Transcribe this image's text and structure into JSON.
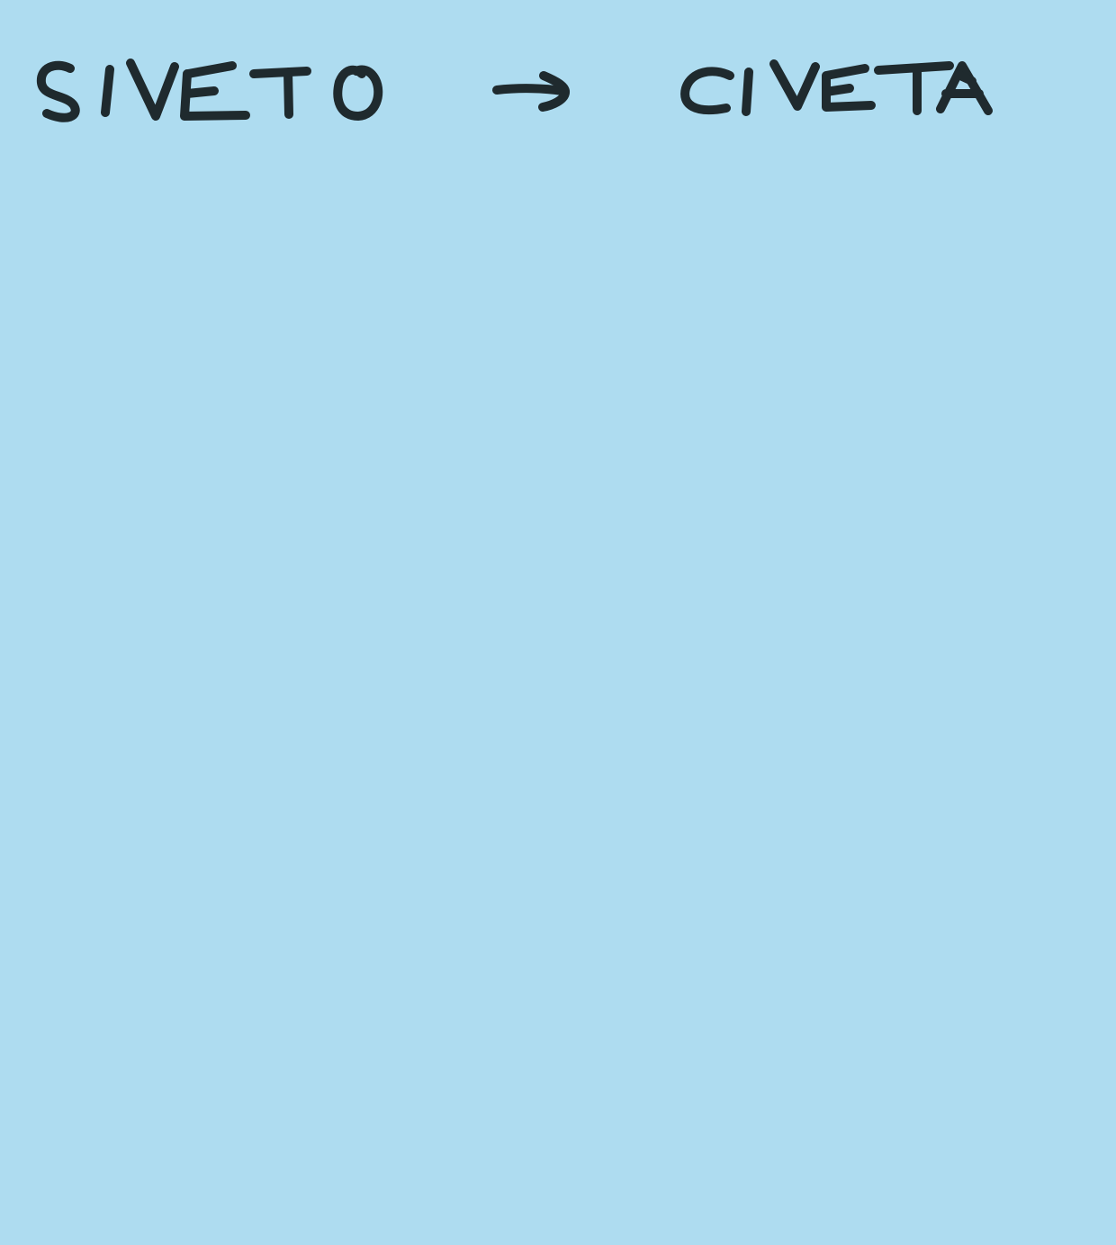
{
  "note": {
    "background_color": "#aedcf0",
    "ink_color": "#1f2a2e",
    "source_word": "SIVETO",
    "arrow": "→",
    "target_word": "CIVETA"
  }
}
